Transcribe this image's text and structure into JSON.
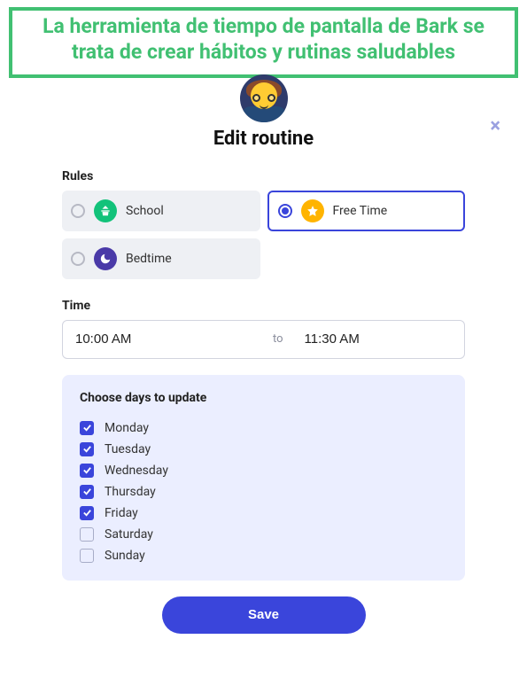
{
  "banner": {
    "text": "La herramienta de tiempo de pantalla de Bark se trata de crear hábitos y rutinas saludables"
  },
  "modal": {
    "title": "Edit routine",
    "close": "×"
  },
  "rules": {
    "label": "Rules",
    "options": [
      {
        "id": "school",
        "label": "School",
        "selected": false
      },
      {
        "id": "freetime",
        "label": "Free Time",
        "selected": true
      },
      {
        "id": "bedtime",
        "label": "Bedtime",
        "selected": false
      }
    ]
  },
  "time": {
    "label": "Time",
    "start": "10:00 AM",
    "to": "to",
    "end": "11:30 AM"
  },
  "days": {
    "title": "Choose days to update",
    "items": [
      {
        "label": "Monday",
        "checked": true
      },
      {
        "label": "Tuesday",
        "checked": true
      },
      {
        "label": "Wednesday",
        "checked": true
      },
      {
        "label": "Thursday",
        "checked": true
      },
      {
        "label": "Friday",
        "checked": true
      },
      {
        "label": "Saturday",
        "checked": false
      },
      {
        "label": "Sunday",
        "checked": false
      }
    ]
  },
  "actions": {
    "save": "Save"
  }
}
